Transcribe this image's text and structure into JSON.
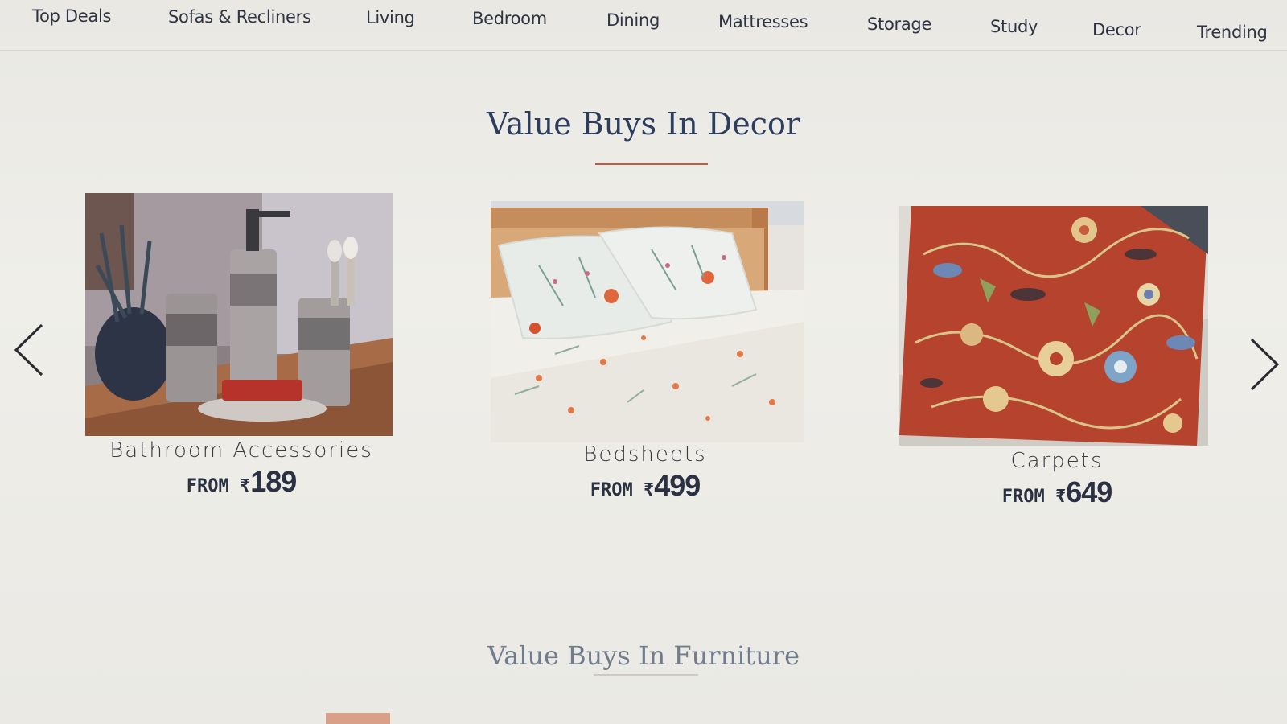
{
  "nav": {
    "items": [
      {
        "label": "Top Deals"
      },
      {
        "label": "Sofas & Recliners"
      },
      {
        "label": "Living"
      },
      {
        "label": "Bedroom"
      },
      {
        "label": "Dining"
      },
      {
        "label": "Mattresses"
      },
      {
        "label": "Storage"
      },
      {
        "label": "Study"
      },
      {
        "label": "Decor"
      },
      {
        "label": "Trending"
      }
    ]
  },
  "decor_section": {
    "title": "Value Buys In Decor",
    "underline_color": "#c0594a",
    "carousel": {
      "prev_icon": "chevron-left-icon",
      "next_icon": "chevron-right-icon"
    },
    "cards": [
      {
        "name": "Bathroom Accessories",
        "price_prefix": "FROM ₹",
        "price": "189"
      },
      {
        "name": "Bedsheets",
        "price_prefix": "FROM ₹",
        "price": "499"
      },
      {
        "name": "Carpets",
        "price_prefix": "FROM ₹",
        "price": "649"
      }
    ]
  },
  "furniture_section": {
    "title": "Value Buys In Furniture"
  },
  "colors": {
    "title_navy": "#2d3e5c",
    "accent_red": "#c0594a"
  }
}
